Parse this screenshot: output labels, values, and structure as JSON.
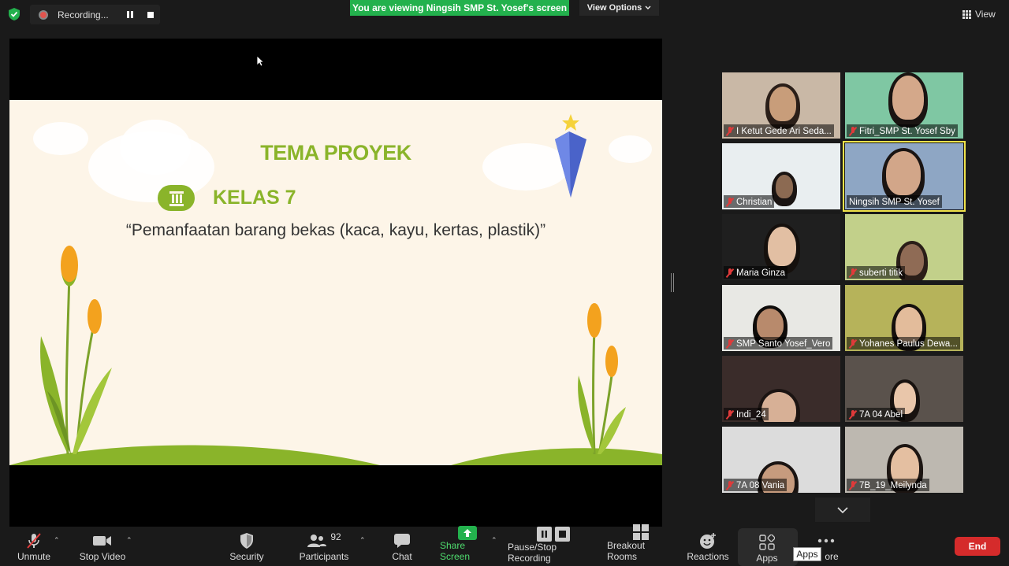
{
  "topbar": {
    "recording_label": "Recording...",
    "viewing_banner": "You are viewing Ningsih SMP St. Yosef's screen",
    "view_options_label": "View Options",
    "view_label": "View"
  },
  "slide": {
    "title": "TEMA PROYEK",
    "kelas": "KELAS 7",
    "subtitle": "“Pemanfaatan barang bekas (kaca, kayu, kertas, plastik)”"
  },
  "participants": [
    {
      "name": "I Ketut Gede Ari Seda...",
      "muted": true,
      "active": false
    },
    {
      "name": "Fitri_SMP St. Yosef Sby",
      "muted": true,
      "active": false
    },
    {
      "name": "Christian",
      "muted": true,
      "active": false
    },
    {
      "name": "Ningsih SMP St. Yosef",
      "muted": false,
      "active": true
    },
    {
      "name": "Maria Ginza",
      "muted": true,
      "active": false
    },
    {
      "name": "suberti titik",
      "muted": true,
      "active": false
    },
    {
      "name": "SMP Santo Yosef_Vero",
      "muted": true,
      "active": false
    },
    {
      "name": "Yohanes Paulus Dewa...",
      "muted": true,
      "active": false
    },
    {
      "name": "Indi_24",
      "muted": true,
      "active": false
    },
    {
      "name": "7A 04 Abel",
      "muted": true,
      "active": false
    },
    {
      "name": "7A 08 Vania",
      "muted": true,
      "active": false
    },
    {
      "name": "7B_19_Meilynda",
      "muted": true,
      "active": false
    }
  ],
  "toolbar": {
    "unmute": "Unmute",
    "stop_video": "Stop Video",
    "security": "Security",
    "participants": "Participants",
    "participant_count": "92",
    "chat": "Chat",
    "share_screen": "Share Screen",
    "pause_stop_recording": "Pause/Stop Recording",
    "breakout_rooms": "Breakout Rooms",
    "reactions": "Reactions",
    "apps": "Apps",
    "more": "ore",
    "apps_tooltip": "Apps",
    "end": "End"
  },
  "colors": {
    "banner_green": "#23b14d",
    "end_red": "#d52b2b",
    "slide_green": "#8ab42a",
    "active_speaker": "#f0e24a"
  }
}
